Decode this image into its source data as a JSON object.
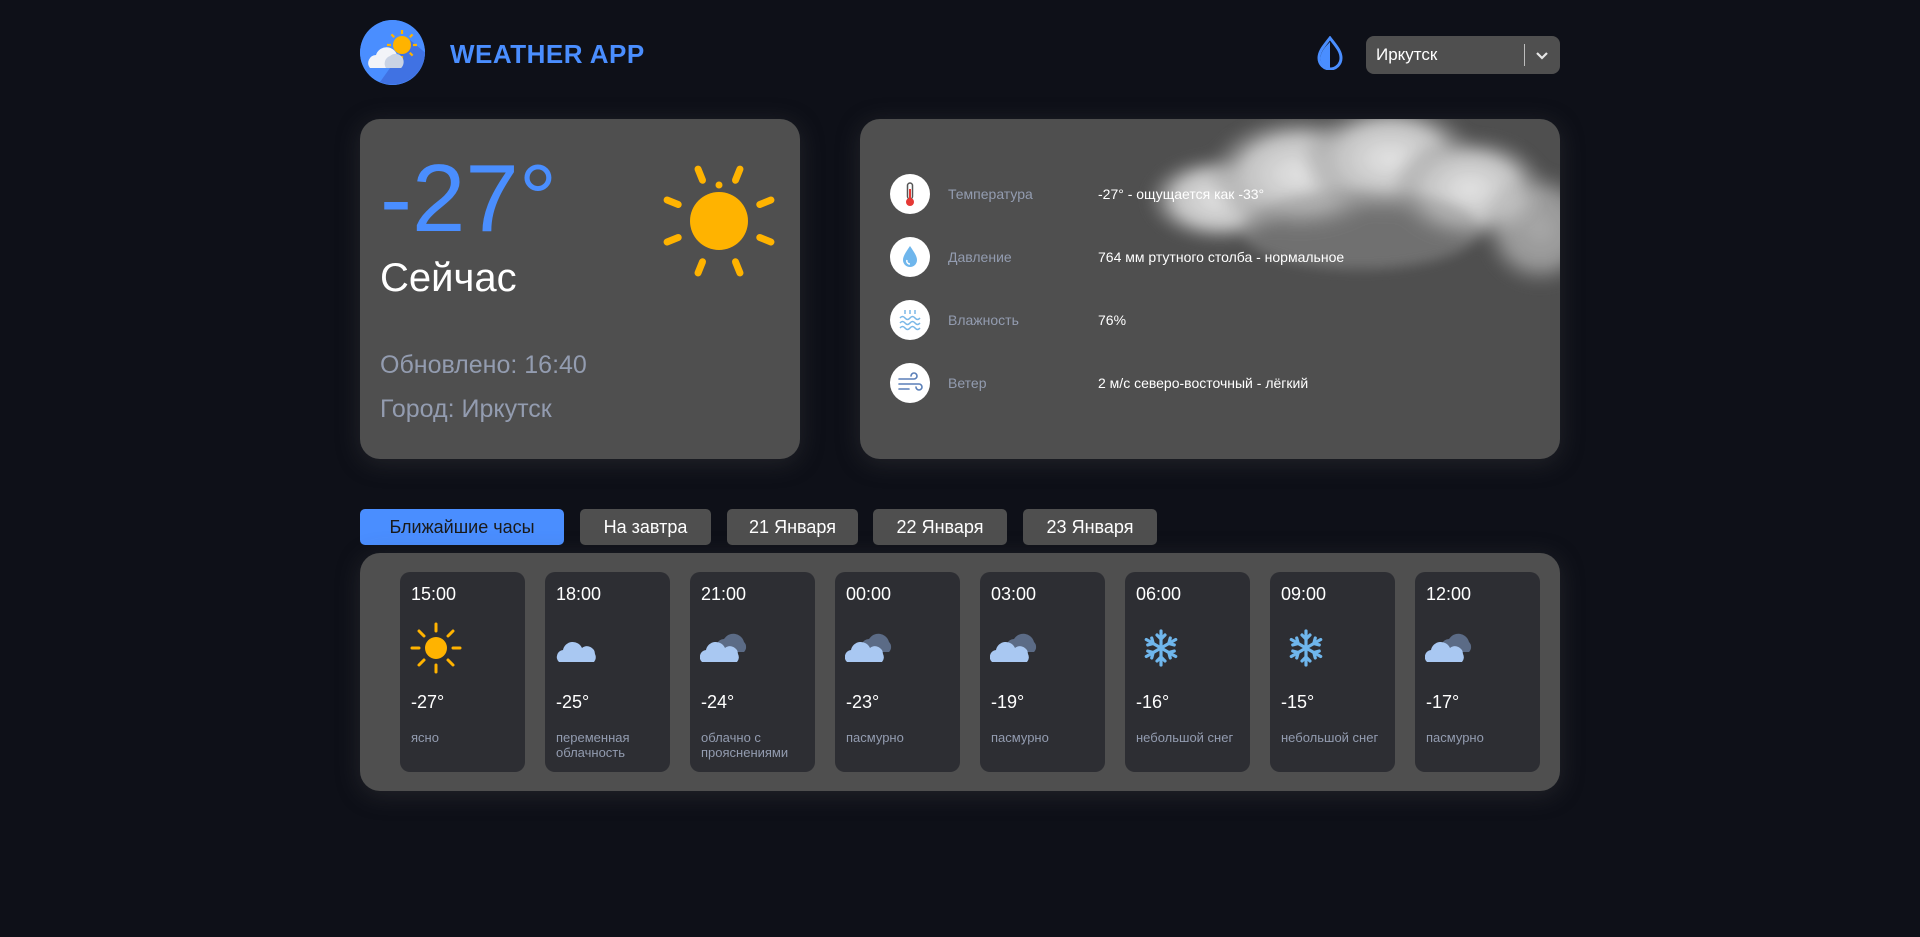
{
  "header": {
    "brand": "WEATHER APP",
    "city_select": {
      "selected": "Иркутск"
    }
  },
  "icons": {
    "logo": "weather-logo-icon",
    "theme": "drop-icon",
    "chevron": "chevron-down-icon"
  },
  "colors": {
    "accent": "#4a8eff",
    "background": "#0e1018",
    "card": "#4f4f4f",
    "forecast_card": "#2d2e33",
    "muted_text": "#939cb0",
    "sun": "#ffb300"
  },
  "now": {
    "temperature": "-27°",
    "label": "Сейчас",
    "updated": "Обновлено: 16:40",
    "city": "Город: Иркутск",
    "icon": "sun-icon"
  },
  "details": [
    {
      "name": "Температура",
      "value": "-27° - ощущается как -33°",
      "icon": "thermometer-icon"
    },
    {
      "name": "Давление",
      "value": "764 мм ртутного столба - нормальное",
      "icon": "pressure-drop-icon"
    },
    {
      "name": "Влажность",
      "value": "76%",
      "icon": "humidity-icon"
    },
    {
      "name": "Ветер",
      "value": "2 м/с северо-восточный - лёгкий",
      "icon": "wind-icon"
    }
  ],
  "tabs": [
    {
      "label": "Ближайшие часы",
      "active": true
    },
    {
      "label": "На завтра",
      "active": false
    },
    {
      "label": "21 Января",
      "active": false
    },
    {
      "label": "22 Января",
      "active": false
    },
    {
      "label": "23 Января",
      "active": false
    }
  ],
  "forecast": [
    {
      "time": "15:00",
      "temp": "-27°",
      "desc": "ясно",
      "icon": "sun-icon"
    },
    {
      "time": "18:00",
      "temp": "-25°",
      "desc": "переменная облачность",
      "icon": "cloud-icon"
    },
    {
      "time": "21:00",
      "temp": "-24°",
      "desc": "облачно с прояснениями",
      "icon": "clouds-icon"
    },
    {
      "time": "00:00",
      "temp": "-23°",
      "desc": "пасмурно",
      "icon": "clouds-icon"
    },
    {
      "time": "03:00",
      "temp": "-19°",
      "desc": "пасмурно",
      "icon": "clouds-icon"
    },
    {
      "time": "06:00",
      "temp": "-16°",
      "desc": "небольшой снег",
      "icon": "snowflake-icon"
    },
    {
      "time": "09:00",
      "temp": "-15°",
      "desc": "небольшой снег",
      "icon": "snowflake-icon"
    },
    {
      "time": "12:00",
      "temp": "-17°",
      "desc": "пасмурно",
      "icon": "clouds-icon"
    }
  ]
}
